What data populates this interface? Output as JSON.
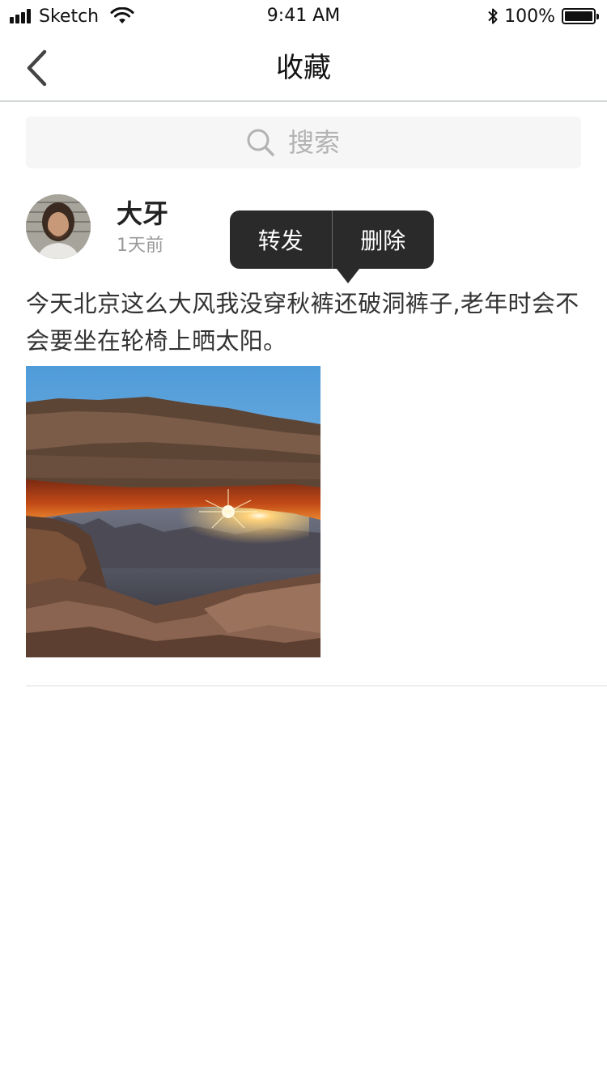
{
  "status_bar": {
    "carrier": "Sketch",
    "time": "9:41 AM",
    "battery": "100%",
    "battery_level": 1.0
  },
  "nav": {
    "title": "收藏",
    "back_icon": "chevron-left-icon"
  },
  "search": {
    "placeholder": "搜索",
    "value": "",
    "icon": "search-icon"
  },
  "post": {
    "user_name": "大牙",
    "time": "1天前",
    "content": "今天北京这么大风我没穿秋裤还破洞裤子,老年时会不会要坐在轮椅上晒太阳。"
  },
  "popover": {
    "forward_label": "转发",
    "delete_label": "删除"
  },
  "colors": {
    "popover_bg": "#2a2a2a",
    "search_bg": "#f6f6f6",
    "nav_border": "#cfd6d4",
    "secondary_text": "#999999"
  }
}
